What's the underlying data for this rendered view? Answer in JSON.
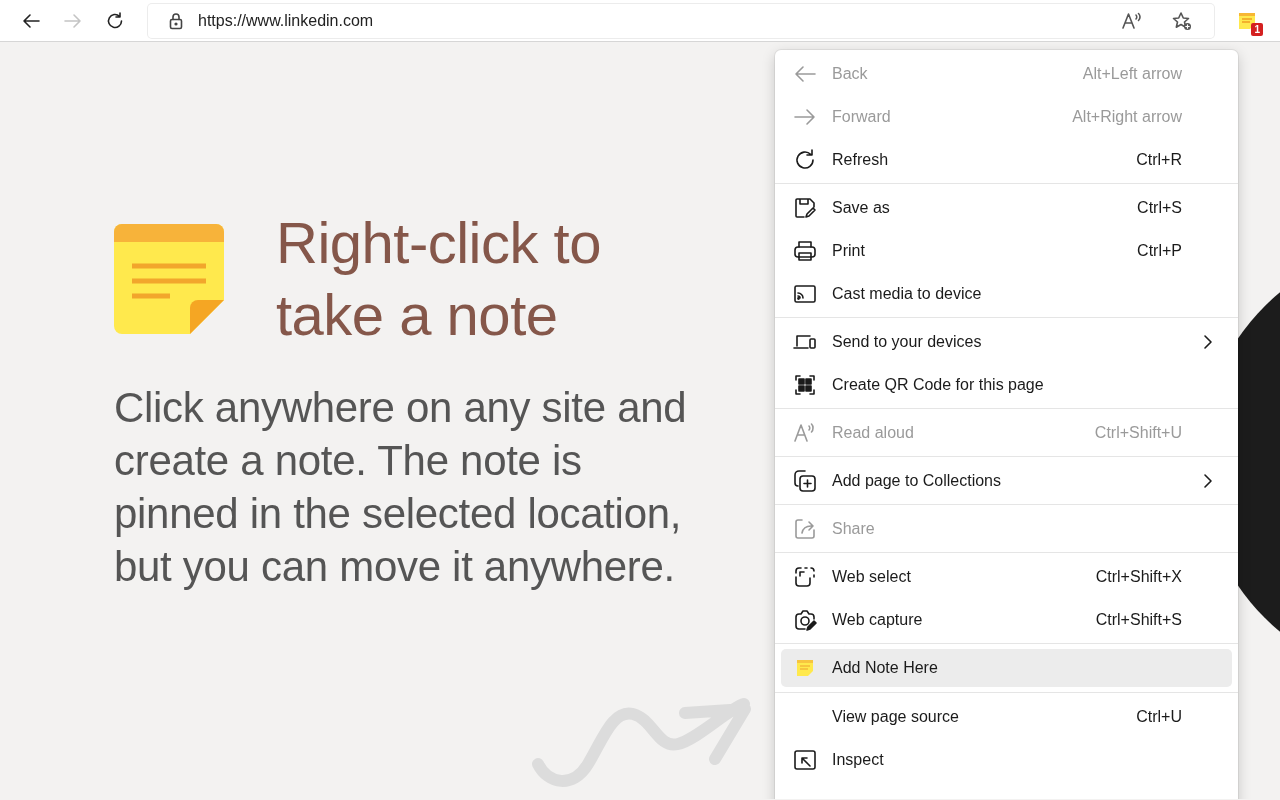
{
  "toolbar": {
    "url": "https://www.linkedin.com",
    "extension_badge": "1"
  },
  "hero": {
    "heading": "Right-click to take a note",
    "text": "Click anywhere on any site and create a note. The note is pinned in the selected location, but you can move it anywhere."
  },
  "context_menu": {
    "groups": [
      [
        {
          "label": "Back",
          "shortcut": "Alt+Left arrow",
          "disabled": true,
          "submenu": false,
          "selected": false
        },
        {
          "label": "Forward",
          "shortcut": "Alt+Right arrow",
          "disabled": true,
          "submenu": false,
          "selected": false
        },
        {
          "label": "Refresh",
          "shortcut": "Ctrl+R",
          "disabled": false,
          "submenu": false,
          "selected": false
        }
      ],
      [
        {
          "label": "Save as",
          "shortcut": "Ctrl+S",
          "disabled": false,
          "submenu": false,
          "selected": false
        },
        {
          "label": "Print",
          "shortcut": "Ctrl+P",
          "disabled": false,
          "submenu": false,
          "selected": false
        },
        {
          "label": "Cast media to device",
          "disabled": false,
          "submenu": false,
          "selected": false
        }
      ],
      [
        {
          "label": "Send to your devices",
          "disabled": false,
          "submenu": true,
          "selected": false
        },
        {
          "label": "Create QR Code for this page",
          "disabled": false,
          "submenu": false,
          "selected": false
        }
      ],
      [
        {
          "label": "Read aloud",
          "shortcut": "Ctrl+Shift+U",
          "disabled": true,
          "submenu": false,
          "selected": false
        }
      ],
      [
        {
          "label": "Add page to Collections",
          "disabled": false,
          "submenu": true,
          "selected": false
        }
      ],
      [
        {
          "label": "Share",
          "disabled": true,
          "submenu": false,
          "selected": false
        }
      ],
      [
        {
          "label": "Web select",
          "shortcut": "Ctrl+Shift+X",
          "disabled": false,
          "submenu": false,
          "selected": false
        },
        {
          "label": "Web capture",
          "shortcut": "Ctrl+Shift+S",
          "disabled": false,
          "submenu": false,
          "selected": false
        }
      ],
      [
        {
          "label": "Add Note Here",
          "disabled": false,
          "submenu": false,
          "selected": true
        }
      ],
      [
        {
          "label": "View page source",
          "shortcut": "Ctrl+U",
          "disabled": false,
          "submenu": false,
          "selected": false
        },
        {
          "label": "Inspect",
          "disabled": false,
          "submenu": false,
          "selected": false
        }
      ]
    ]
  }
}
